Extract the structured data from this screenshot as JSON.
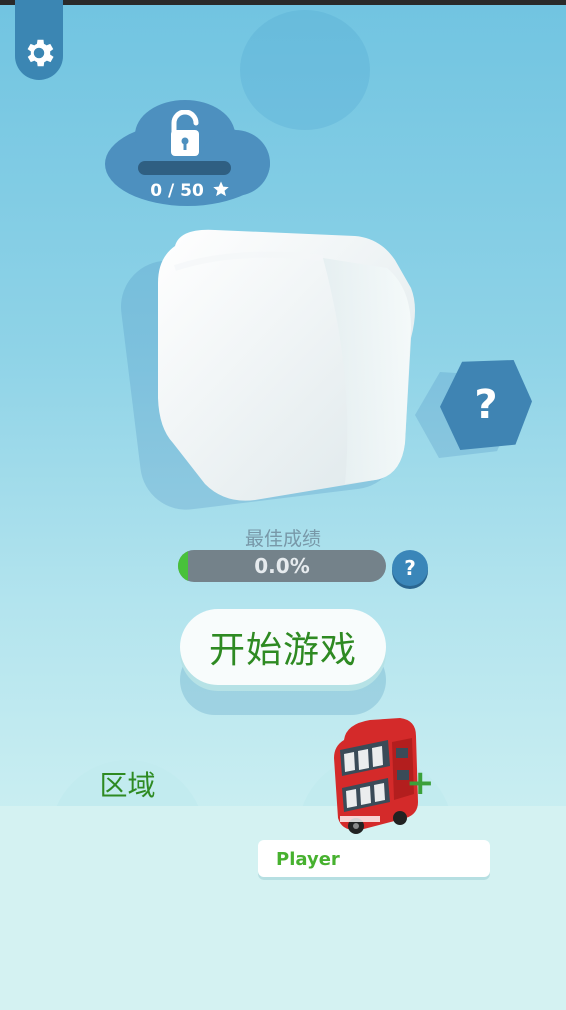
{
  "settings": {
    "icon": "gear-icon"
  },
  "unlock": {
    "icon": "lock-icon",
    "progress_text": "0 / 50",
    "star_icon": "star-icon",
    "progress_fraction": 0
  },
  "help": {
    "big_label": "?",
    "small_label": "?"
  },
  "best_score": {
    "label": "最佳成绩",
    "percent_text": "0.0%",
    "progress_fraction": 0.0
  },
  "start_button": {
    "label": "开始游戏"
  },
  "bottom": {
    "region_label": "区域",
    "vehicle_icon": "double-decker-bus-icon",
    "add_icon": "plus-icon",
    "add_label": "+",
    "player_name": "Player"
  },
  "colors": {
    "accent_blue": "#3f84b3",
    "start_text_green": "#2e8a22",
    "progress_green": "#48c13a",
    "bus_red": "#d42a2a"
  }
}
